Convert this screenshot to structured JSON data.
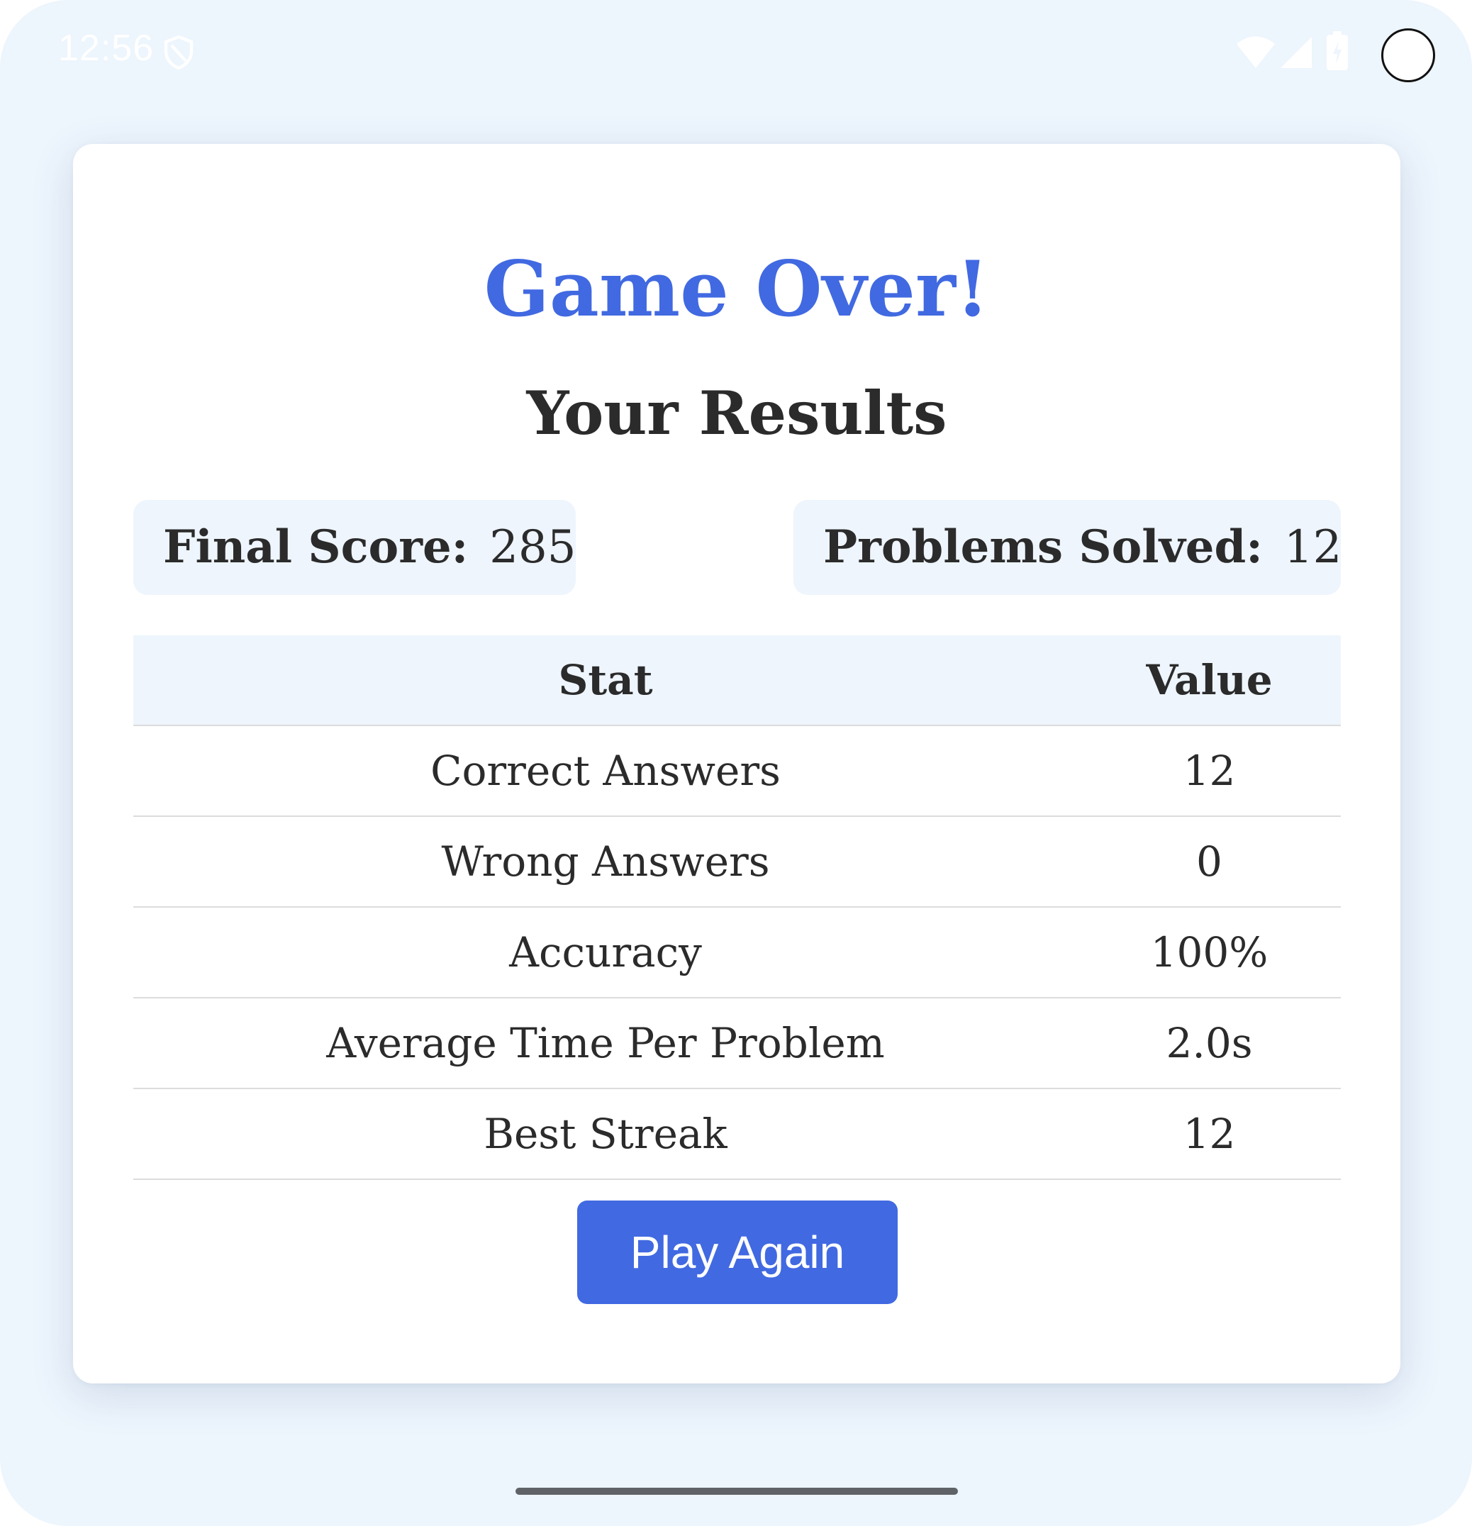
{
  "status_bar": {
    "time": "12:56",
    "icons": [
      "shield-icon",
      "wifi-icon",
      "signal-icon",
      "battery-icon"
    ]
  },
  "results": {
    "title": "Game Over!",
    "subtitle": "Your Results",
    "final_score_label": "Final Score:",
    "final_score_value": "285",
    "problems_solved_label": "Problems Solved:",
    "problems_solved_value": "12",
    "table": {
      "headers": [
        "Stat",
        "Value"
      ],
      "rows": [
        {
          "stat": "Correct Answers",
          "value": "12"
        },
        {
          "stat": "Wrong Answers",
          "value": "0"
        },
        {
          "stat": "Accuracy",
          "value": "100%"
        },
        {
          "stat": "Average Time Per Problem",
          "value": "2.0s"
        },
        {
          "stat": "Best Streak",
          "value": "12"
        }
      ]
    },
    "play_again_label": "Play Again"
  },
  "colors": {
    "accent": "#4169e1",
    "background": "#edf5fd",
    "card": "#ffffff",
    "text": "#2b2b2b",
    "highlight_box": "#eef5fd"
  }
}
